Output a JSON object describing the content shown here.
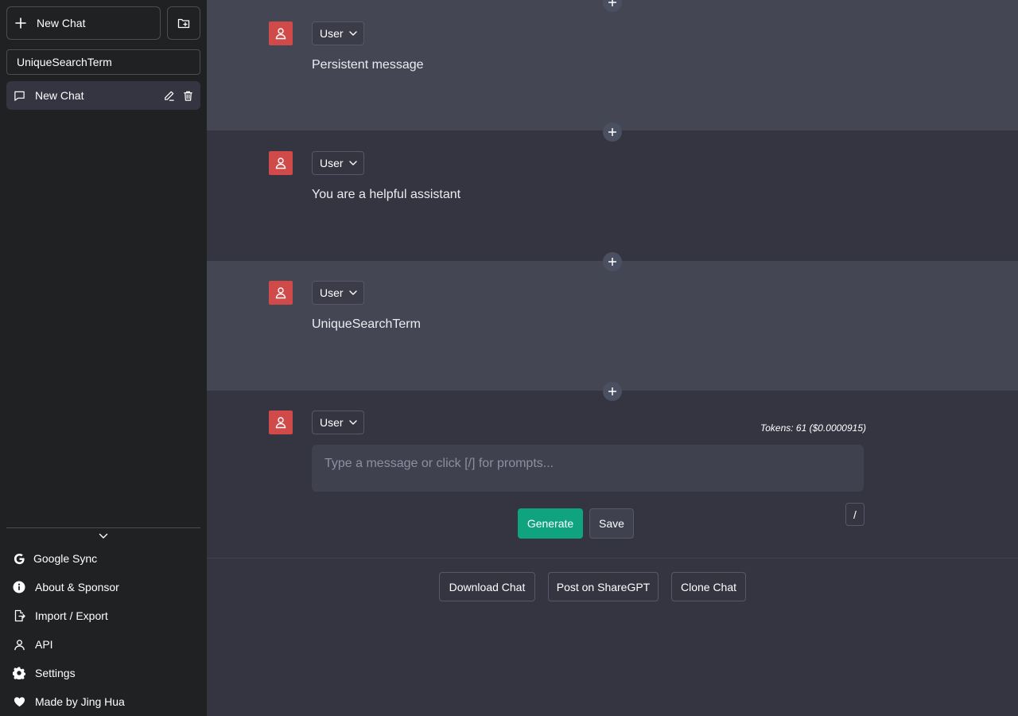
{
  "sidebar": {
    "new_chat_label": "New Chat",
    "search_value": "UniqueSearchTerm",
    "chats": [
      {
        "label": "New Chat"
      }
    ],
    "menu": [
      {
        "label": "Google Sync",
        "icon": "google-icon"
      },
      {
        "label": "About & Sponsor",
        "icon": "info-icon"
      },
      {
        "label": "Import / Export",
        "icon": "file-export-icon"
      },
      {
        "label": "API",
        "icon": "person-icon"
      },
      {
        "label": "Settings",
        "icon": "gear-icon"
      },
      {
        "label": "Made by Jing Hua",
        "icon": "heart-icon"
      }
    ]
  },
  "messages": [
    {
      "role": "User",
      "text": "Persistent message"
    },
    {
      "role": "User",
      "text": "You are a helpful assistant"
    },
    {
      "role": "User",
      "text": "UniqueSearchTerm"
    }
  ],
  "composer": {
    "role": "User",
    "tokens": "Tokens: 61 ($0.0000915)",
    "placeholder": "Type a message or click [/] for prompts...",
    "generate_label": "Generate",
    "save_label": "Save",
    "slash_label": "/"
  },
  "footer": {
    "download_label": "Download Chat",
    "share_label": "Post on ShareGPT",
    "clone_label": "Clone Chat"
  },
  "colors": {
    "sidebar_bg": "#202123",
    "main_bg": "#343541",
    "message_alt_bg": "#444654",
    "avatar": "#d04a4a",
    "generate": "#10a37f"
  }
}
